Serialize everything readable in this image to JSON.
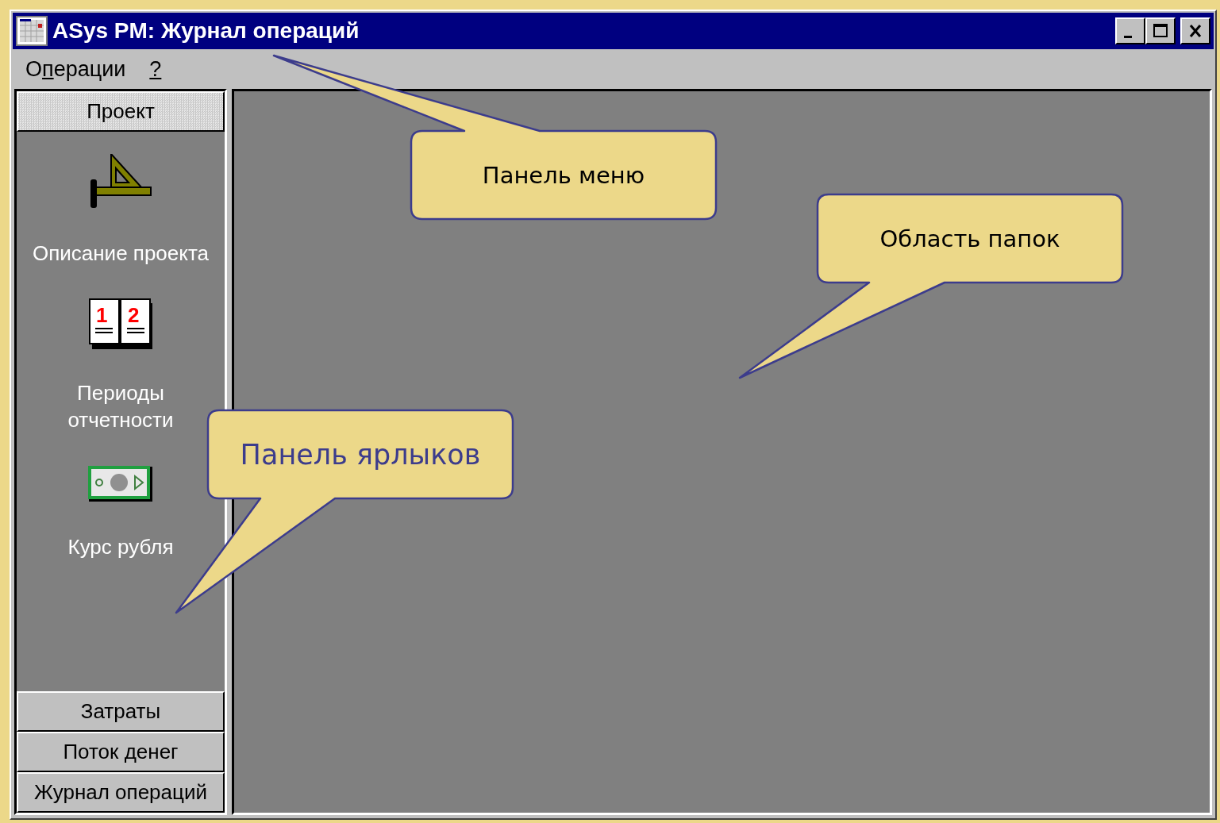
{
  "window": {
    "title": "ASys PM: Журнал операций"
  },
  "menu": [
    {
      "before": "О",
      "key": "п",
      "after": "ерации"
    },
    {
      "key": "?"
    }
  ],
  "sidebar": {
    "groups": [
      {
        "label": "Проект",
        "selected": true
      },
      {
        "label": "Затраты",
        "selected": false
      },
      {
        "label": "Поток денег",
        "selected": false
      },
      {
        "label": "Журнал операций",
        "selected": false
      }
    ],
    "items": [
      {
        "label": "Описание проекта",
        "kind": "ruler"
      },
      {
        "label": "Периоды отчетности",
        "kind": "calendar",
        "icon_digits": [
          "1",
          "2"
        ]
      },
      {
        "label": "Курс рубля",
        "kind": "money"
      }
    ]
  },
  "callouts": [
    {
      "text": "Панель меню",
      "highlighted": false
    },
    {
      "text": "Область папок",
      "highlighted": false
    },
    {
      "text": "Панель ярлыков",
      "highlighted": true
    }
  ]
}
